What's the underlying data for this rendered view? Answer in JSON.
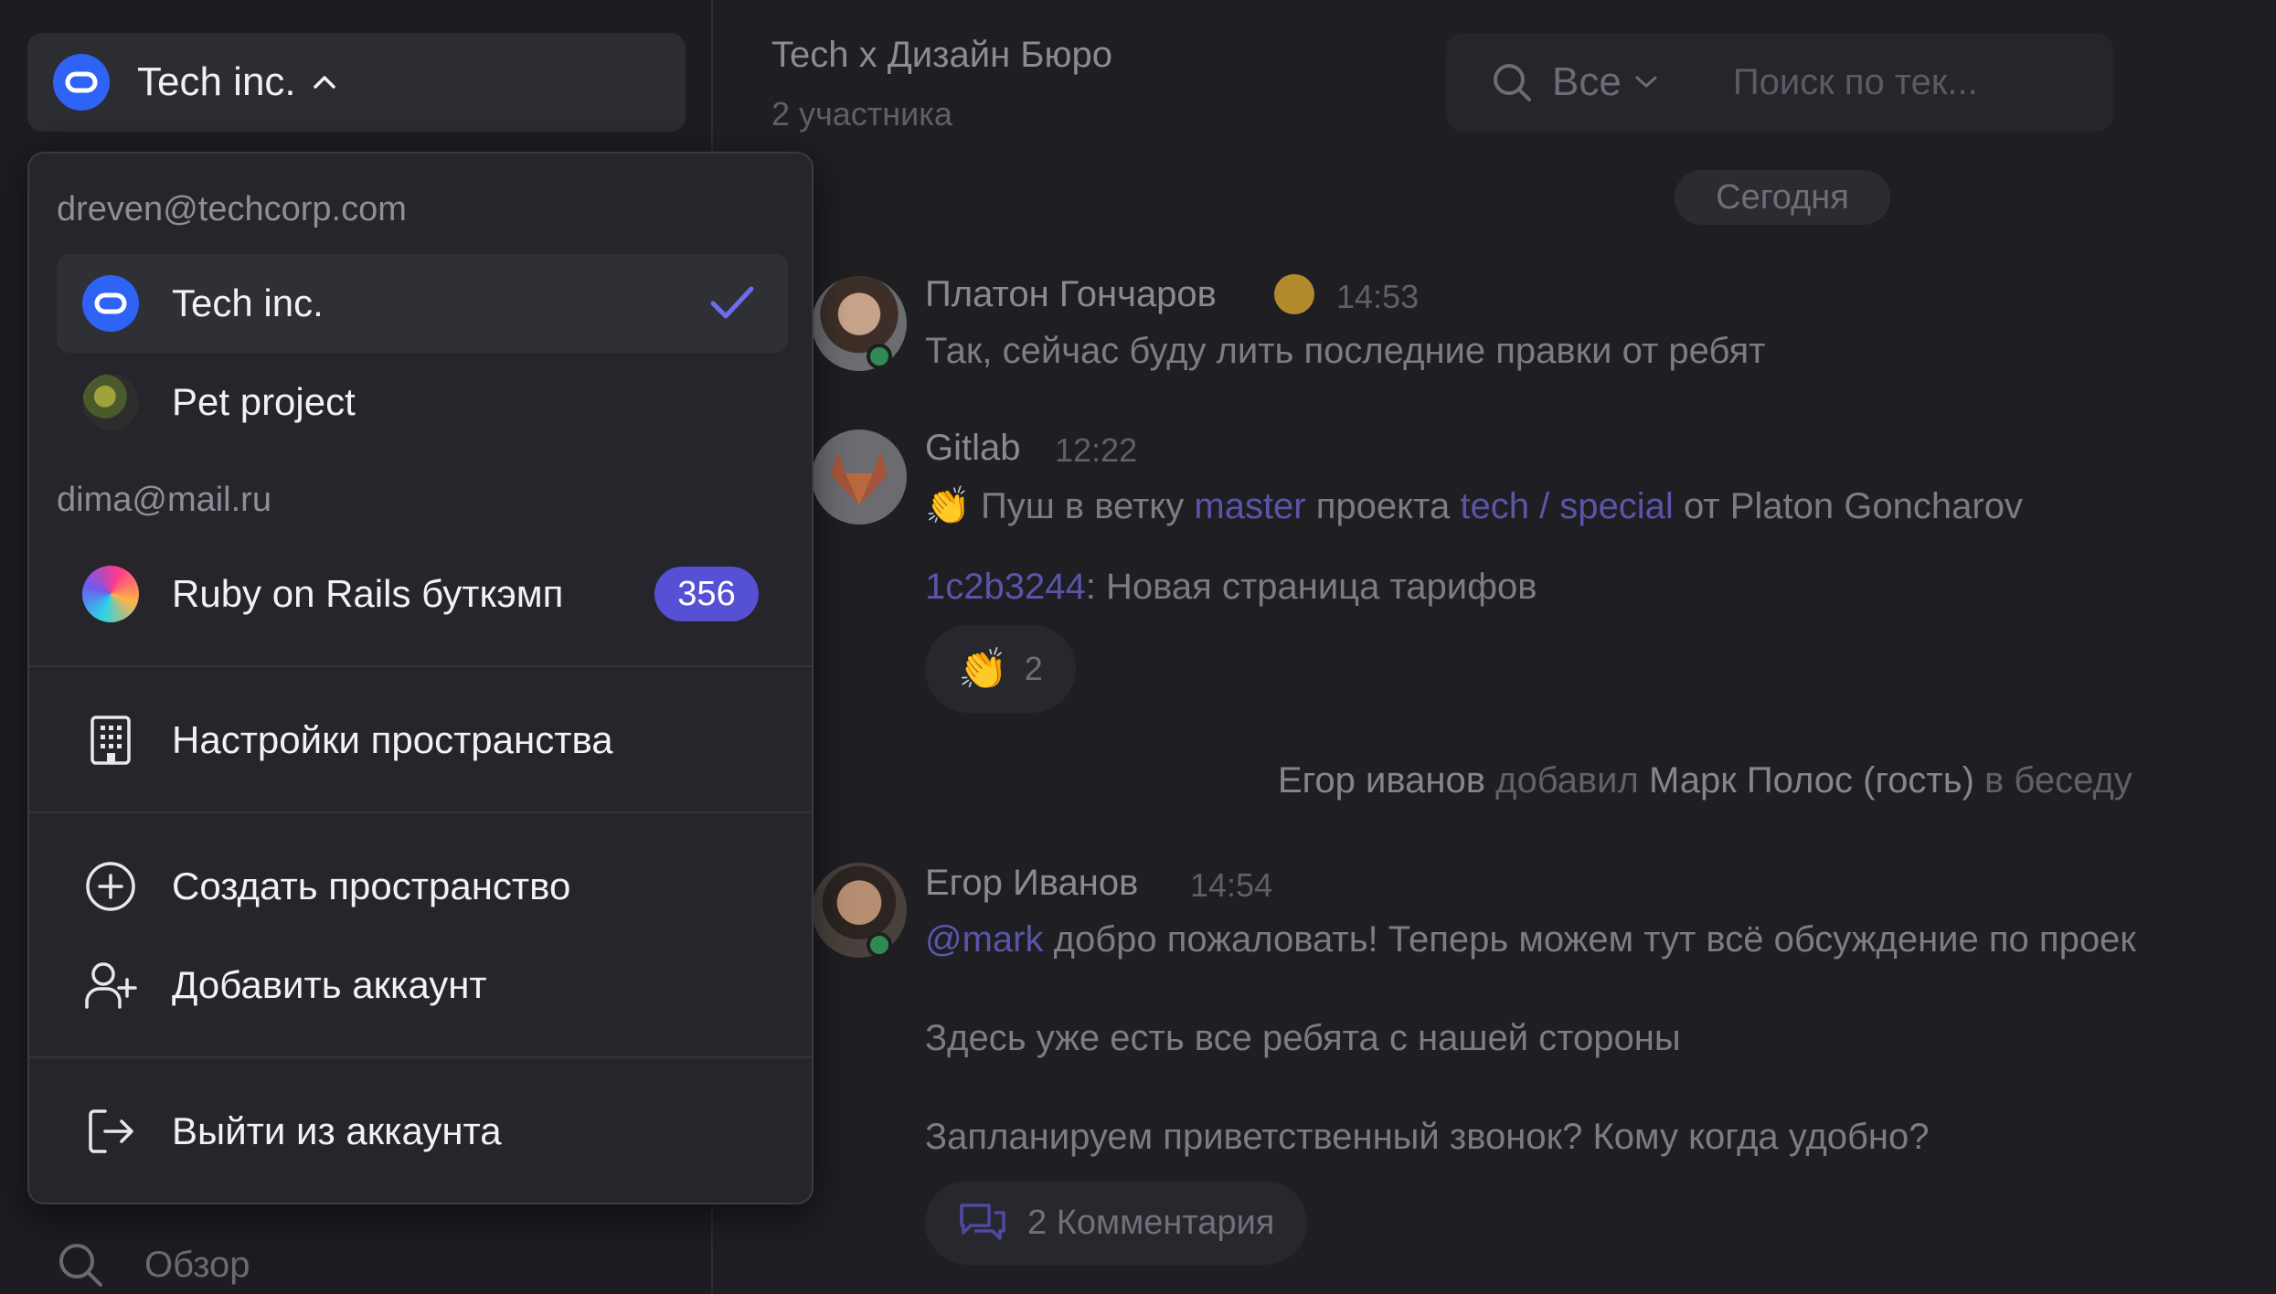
{
  "workspace_switcher": {
    "name": "Tech inc."
  },
  "sidebar": {
    "overview_label": "Обзор"
  },
  "chat": {
    "title": "Tech x Дизайн Бюро",
    "subtitle": "2 участника",
    "search": {
      "filter": "Все",
      "placeholder": "Поиск по тек..."
    },
    "date_divider": "Сегодня",
    "messages": [
      {
        "author": "Платон Гончаров",
        "time": "14:53",
        "text": "Так, сейчас буду лить последние правки от ребят"
      },
      {
        "author": "Gitlab",
        "time": "12:22",
        "line1_pre": "Пуш в ветку",
        "branch": "master",
        "line1_mid": "проекта",
        "project": "tech / special",
        "line1_post": "от Platon Goncharov",
        "commit": "1c2b3244",
        "commit_text": ": Новая страница тарифов",
        "reaction_count": "2"
      },
      {
        "author": "Егор Иванов",
        "time": "14:54",
        "mention": "@mark",
        "text1": "добро пожаловать! Теперь можем тут всё обсуждение по проек",
        "text2": "Здесь уже есть все ребята с нашей стороны",
        "text3": "Запланируем приветственный звонок? Кому когда удобно?",
        "comments": "2 Комментария"
      }
    ],
    "system": {
      "actor": "Егор иванов",
      "verb": "добавил",
      "target": "Марк Полос (гость)",
      "suffix": "в беседу"
    }
  },
  "dropdown": {
    "account1_email": "dreven@techcorp.com",
    "account1_spaces": [
      "Tech inc.",
      "Pet project"
    ],
    "account2_email": "dima@mail.ru",
    "account2_spaces": [
      "Ruby on Rails буткэмп"
    ],
    "account2_badge": "356",
    "settings": "Настройки пространства",
    "create": "Создать пространство",
    "add_account": "Добавить аккаунт",
    "logout": "Выйти из аккаунта"
  },
  "colors": {
    "accent": "#2f63f5",
    "badge": "#5650d4",
    "check": "#6f6cf0",
    "online": "#2f8a53"
  }
}
